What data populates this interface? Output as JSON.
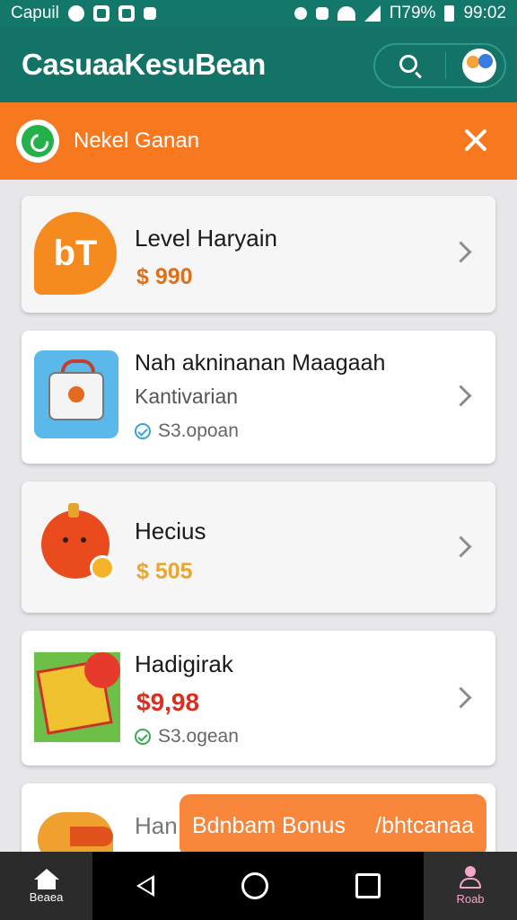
{
  "status_bar": {
    "carrier": "Capuil",
    "battery": "Π79%",
    "time": "99:02"
  },
  "app_bar": {
    "title": "CasuaaKesuBean"
  },
  "banner": {
    "text": "Nekel Ganan"
  },
  "games": [
    {
      "title": "Level Haryain",
      "price": "$ 990",
      "icon_text": "bT"
    },
    {
      "title": "Nah akninanan Maagaah",
      "subtitle": "Kantivarian",
      "tag": "S3.opoan"
    },
    {
      "title": "Hecius",
      "price": "$ 505"
    },
    {
      "title": "Hadigirak",
      "price": "$9,98",
      "tag": "S3.ogean"
    },
    {
      "title": "Han"
    }
  ],
  "promo": {
    "label": "Bdnbam Bonus",
    "sublabel": "/bhtcanaa"
  },
  "nav": {
    "home_label": "Beaea",
    "profile_label": "Roab"
  },
  "colors": {
    "primary": "#137367",
    "banner": "#f7781f",
    "promo": "#f7853a"
  }
}
